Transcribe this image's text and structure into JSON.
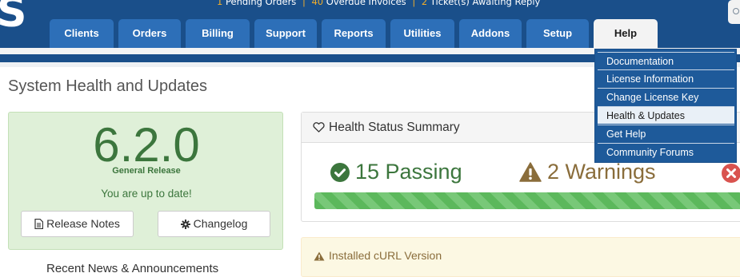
{
  "header": {
    "brand_letter": "S",
    "notifications": {
      "pending_orders_count": "1",
      "pending_orders_label": "Pending Orders",
      "overdue_invoices_count": "40",
      "overdue_invoices_label": "Overdue Invoices",
      "tickets_count": "2",
      "tickets_label": "Ticket(s) Awaiting Reply",
      "separator": "|"
    }
  },
  "nav": {
    "tabs": [
      {
        "label": "Clients"
      },
      {
        "label": "Orders"
      },
      {
        "label": "Billing"
      },
      {
        "label": "Support"
      },
      {
        "label": "Reports"
      },
      {
        "label": "Utilities"
      },
      {
        "label": "Addons"
      },
      {
        "label": "Setup"
      },
      {
        "label": "Help"
      }
    ],
    "help_menu": [
      {
        "label": "Documentation"
      },
      {
        "label": "License Information"
      },
      {
        "label": "Change License Key"
      },
      {
        "label": "Health & Updates"
      },
      {
        "label": "Get Help"
      },
      {
        "label": "Community Forums"
      }
    ]
  },
  "page": {
    "title": "System Health and Updates"
  },
  "version_panel": {
    "version": "6.2.0",
    "release_type": "General Release",
    "status": "You are up to date!",
    "release_notes_label": "Release Notes",
    "changelog_label": "Changelog"
  },
  "news": {
    "title": "Recent News & Announcements"
  },
  "health": {
    "title": "Health Status Summary",
    "passing": "15 Passing",
    "warnings": "2 Warnings"
  },
  "alert": {
    "text": "Installed cURL Version"
  },
  "colors": {
    "header_bg": "#1a4f8a",
    "tab_bg": "#2d6fb8",
    "accent_yellow": "#f0ad2a",
    "success_green": "#3c763d",
    "warning_brown": "#8a6d3b",
    "error_red": "#d9534f"
  }
}
